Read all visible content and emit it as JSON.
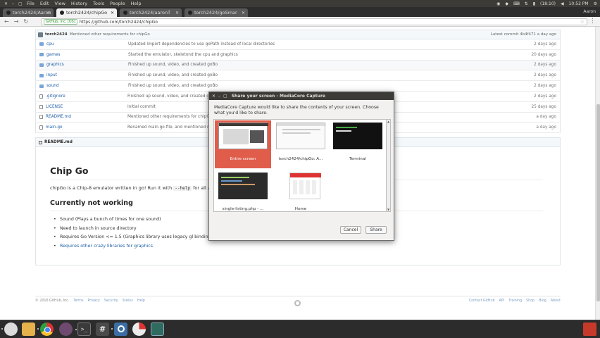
{
  "menubar": {
    "menus": [
      "File",
      "Edit",
      "View",
      "History",
      "Tools",
      "People",
      "Help"
    ],
    "tray": {
      "battery": "(18:10)",
      "time": "10:52 PM"
    }
  },
  "tabs": [
    {
      "label": "torch2424/Aaron"
    },
    {
      "label": "torch2424/chipGo"
    },
    {
      "label": "torch2424/aaronT"
    },
    {
      "label": "torch2424/goSmar"
    }
  ],
  "profile_name": "Aaron",
  "address": {
    "secure_label": "GitHub, Inc. [US]",
    "url": "https://github.com/torch2424/chipGo"
  },
  "commit_bar": {
    "author": "torch2424",
    "message": "Mentioned other requirements for chipGo",
    "latest": "Latest commit 4b4f471 a day ago"
  },
  "files": [
    {
      "type": "dir",
      "name": "cpu",
      "message": "Updated import dependencies to use goPath instead of local directories",
      "age": "2 days ago"
    },
    {
      "type": "dir",
      "name": "games",
      "message": "Started the emulator, skeletond the cpu and graphics",
      "age": "20 days ago"
    },
    {
      "type": "dir",
      "name": "graphics",
      "message": "Finished up sound, video, and created goBo",
      "age": "2 days ago"
    },
    {
      "type": "dir",
      "name": "input",
      "message": "Finished up sound, video, and created goBo",
      "age": "2 days ago"
    },
    {
      "type": "dir",
      "name": "sound",
      "message": "Finished up sound, video, and created goBo",
      "age": "2 days ago"
    },
    {
      "type": "file",
      "name": ".gitignore",
      "message": "Finished up sound, video, and created goBo",
      "age": "2 days ago"
    },
    {
      "type": "file",
      "name": "LICENSE",
      "message": "Initial commit",
      "age": "25 days ago"
    },
    {
      "type": "file",
      "name": "README.md",
      "message": "Mentioned other requirements for chipGo",
      "age": "a day ago"
    },
    {
      "type": "file",
      "name": "main.go",
      "message": "Renamed main.go file, and mentioned re",
      "age": "a day ago"
    }
  ],
  "readme": {
    "header": "README.md",
    "title": "Chip Go",
    "intro_pre": "chipGo is a Chip-8 emulator written in go! Run it with",
    "intro_code": "--help",
    "intro_post": "for all ap",
    "section": "Currently not working",
    "items": [
      "Sound (Plays a bunch of times for one sound)",
      "Need to launch in source directory",
      "Requires Go Version <= 1.5 (Graphics library uses legacy gl bindin"
    ],
    "link_item": "Requires other crazy libraries for graphics"
  },
  "footer": {
    "copyright": "© 2016 GitHub, Inc.",
    "left_links": [
      "Terms",
      "Privacy",
      "Security",
      "Status",
      "Help"
    ],
    "right_links": [
      "Contact GitHub",
      "API",
      "Training",
      "Shop",
      "Blog",
      "About"
    ]
  },
  "dialog": {
    "title": "Share your screen - MediaCore Capture",
    "prompt": "MediaCore Capture would like to share the contents of your screen. Choose what you'd like to share.",
    "sources": [
      {
        "label": "Entire screen",
        "selected": true
      },
      {
        "label": "torch2424/chipGo: A...",
        "selected": false
      },
      {
        "label": "Terminal",
        "selected": false
      },
      {
        "label": "single-listing.php - ...",
        "selected": false
      },
      {
        "label": "Home",
        "selected": false
      }
    ],
    "cancel": "Cancel",
    "share": "Share"
  },
  "colors": {
    "selected_source": "#e05d4c",
    "link": "#1f5fa8",
    "menubar": "#3c3b37"
  }
}
